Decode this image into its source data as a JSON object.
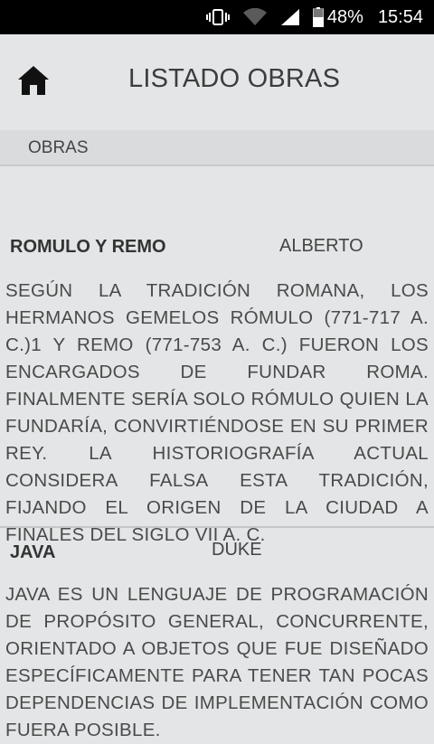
{
  "status_bar": {
    "battery_percent": "48%",
    "time": "15:54",
    "icons": [
      "vibrate-icon",
      "wifi-icon",
      "signal-icon",
      "battery-icon"
    ]
  },
  "app_bar": {
    "title": "LISTADO OBRAS",
    "home_icon": "home-icon"
  },
  "tab_bar": {
    "label": "OBRAS"
  },
  "items": [
    {
      "title": "ROMULO Y REMO",
      "author": "ALBERTO",
      "description": "SEGÚN LA TRADICIÓN ROMANA, LOS HERMANOS GEMELOS RÓMULO (771-717 A. C.)1 Y REMO (771-753 A. C.) FUERON LOS ENCARGADOS DE FUNDAR ROMA. FINALMENTE SERÍA SOLO RÓMULO QUIEN LA FUNDARÍA, CONVIRTIÉNDOSE EN SU PRIMER REY. LA HISTORIOGRAFÍA ACTUAL CONSIDERA FALSA ESTA TRADICIÓN, FIJANDO EL ORIGEN DE LA CIUDAD A FINALES DEL SIGLO VII A. C."
    },
    {
      "title": "JAVA",
      "author": "DUKE",
      "description": "JAVA ES UN LENGUAJE DE PROGRAMACIÓN DE PROPÓSITO GENERAL, CONCURRENTE, ORIENTADO A OBJETOS QUE FUE DISEÑADO ESPECÍFICAMENTE PARA TENER TAN POCAS DEPENDENCIAS DE IMPLEMENTACIÓN COMO FUERA POSIBLE."
    }
  ]
}
